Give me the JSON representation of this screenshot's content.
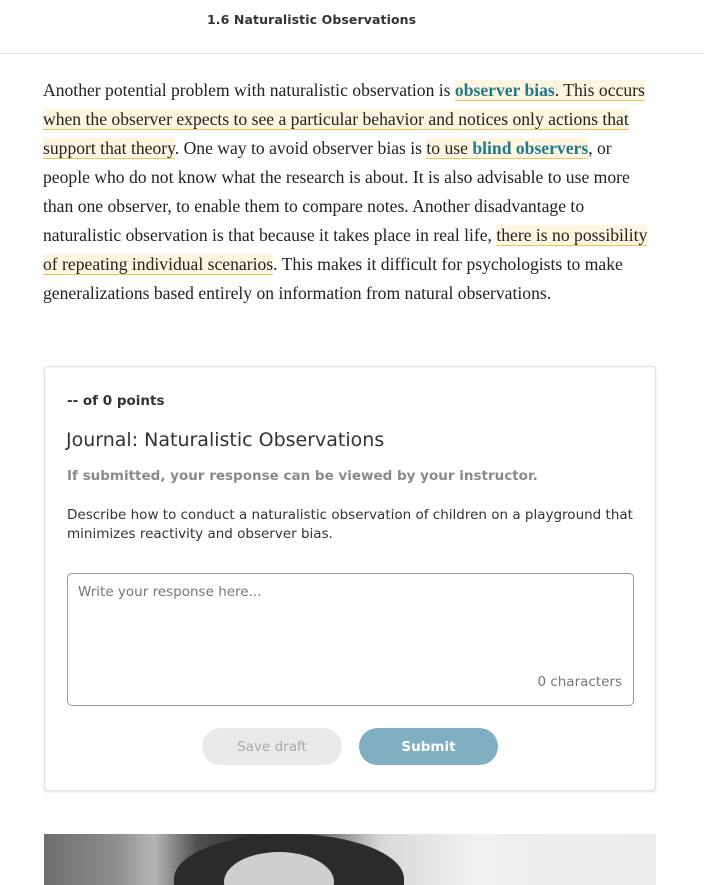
{
  "header": {
    "section_title": "1.6 Naturalistic Observations"
  },
  "reading": {
    "segments": [
      {
        "text": "Another potential problem with naturalistic observation is ",
        "style": "plain"
      },
      {
        "text": "observer bias",
        "style": "term-highlight"
      },
      {
        "text": ". This occurs when the observer expects to see a particular behavior and notices only actions that support that theory",
        "style": "highlight"
      },
      {
        "text": ". One way to avoid observer bias is ",
        "style": "plain"
      },
      {
        "text": "to use ",
        "style": "highlight"
      },
      {
        "text": "blind observers",
        "style": "term-highlight"
      },
      {
        "text": ", or people who do not know what the research is about. It is also advisable to use more than one observer, to enable them to compare notes. Another disadvantage to naturalistic observation is that because it takes place in real life, ",
        "style": "plain"
      },
      {
        "text": "there is no possibility of repeating individual scenarios",
        "style": "highlight"
      },
      {
        "text": ". This makes it difficult for psychologists to make generalizations based entirely on information from natural observations.",
        "style": "plain"
      }
    ]
  },
  "journal": {
    "points": "-- of 0 points",
    "title": "Journal: Naturalistic Observations",
    "notice": "If submitted, your response can be viewed by your instructor.",
    "prompt": "Describe how to conduct a naturalistic observation of children on a playground that minimizes reactivity and observer bias.",
    "response_placeholder": "Write your response here...",
    "response_value": "",
    "char_count": "0 characters",
    "save_draft_label": "Save draft",
    "submit_label": "Submit"
  },
  "colors": {
    "highlight_bg": "#fdf5df",
    "highlight_underline": "#e8c55d",
    "term": "#1f7a8c",
    "submit_bg": "#7fafc1",
    "draft_bg": "#e9e9e9"
  }
}
